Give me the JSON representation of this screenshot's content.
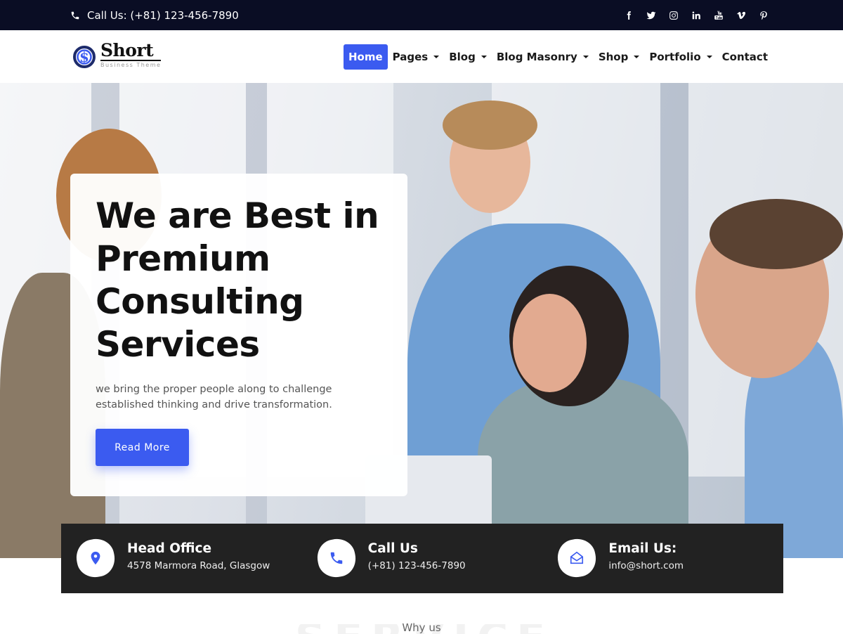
{
  "topbar": {
    "call": "Call Us: (+81) 123-456-7890",
    "socials": [
      "facebook-icon",
      "twitter-icon",
      "instagram-icon",
      "linkedin-icon",
      "youtube-icon",
      "vimeo-icon",
      "pinterest-icon"
    ]
  },
  "logo": {
    "brand": "Short",
    "tagline": "Business Theme"
  },
  "nav": {
    "items": [
      {
        "label": "Home",
        "active": true,
        "dropdown": false
      },
      {
        "label": "Pages",
        "dropdown": true
      },
      {
        "label": "Blog",
        "dropdown": true
      },
      {
        "label": "Blog Masonry",
        "dropdown": true
      },
      {
        "label": "Shop",
        "dropdown": true
      },
      {
        "label": "Portfolio",
        "dropdown": true
      },
      {
        "label": "Contact",
        "dropdown": false
      }
    ]
  },
  "hero": {
    "heading": "We are Best in Premium Consulting Services",
    "text": "we bring the proper people along to challenge established thinking and drive transformation.",
    "button": "Read More"
  },
  "info": [
    {
      "icon": "location-pin-icon",
      "title": "Head Office",
      "sub": "4578 Marmora Road, Glasgow"
    },
    {
      "icon": "phone-icon",
      "title": "Call Us",
      "sub": "(+81) 123-456-7890"
    },
    {
      "icon": "envelope-icon",
      "title": "Email Us:",
      "sub": "info@short.com"
    }
  ],
  "section": {
    "eyebrow": "Why us",
    "ghost": "SERVICE"
  },
  "colors": {
    "accent": "#3b5bf0",
    "topbar": "#0a0d24",
    "strip": "#222222"
  }
}
